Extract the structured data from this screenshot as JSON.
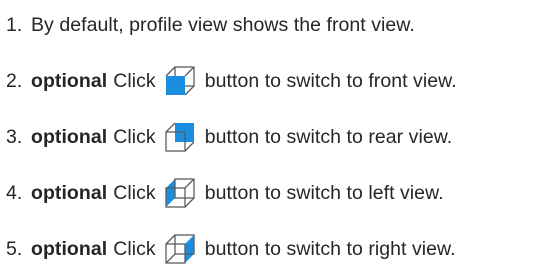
{
  "steps": [
    {
      "number": "1.",
      "text": "By default, profile view shows the front view."
    },
    {
      "number": "2.",
      "optional": "optional",
      "pre": "Click",
      "icon": "cube-front-view-icon",
      "post": "button to switch to front view."
    },
    {
      "number": "3.",
      "optional": "optional",
      "pre": "Click",
      "icon": "cube-rear-view-icon",
      "post": "button to switch to rear view."
    },
    {
      "number": "4.",
      "optional": "optional",
      "pre": "Click",
      "icon": "cube-left-view-icon",
      "post": "button to switch to left view."
    },
    {
      "number": "5.",
      "optional": "optional",
      "pre": "Click",
      "icon": "cube-right-view-icon",
      "post": "button to switch to right view."
    }
  ],
  "colors": {
    "text": "#262626",
    "icon_fill": "#1a8fe0",
    "icon_line": "#5c5c5c"
  }
}
